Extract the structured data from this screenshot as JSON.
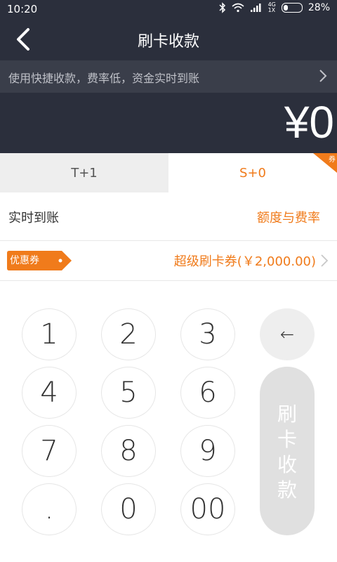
{
  "status": {
    "time": "10:20",
    "network": "4G",
    "signal_sub": "1X",
    "battery": "28%"
  },
  "nav": {
    "title": "刷卡收款"
  },
  "promo": {
    "text": "使用快捷收款，费率低，资金实时到账"
  },
  "amount": {
    "value": "¥0"
  },
  "tabs": [
    {
      "label": "T+1"
    },
    {
      "label": "S+0",
      "badge": "券"
    }
  ],
  "realtime": {
    "label": "实时到账",
    "link": "额度与费率"
  },
  "coupon": {
    "tag": "优惠券",
    "value": "超级刷卡券(￥2,000.00)"
  },
  "keypad": {
    "keys": [
      "1",
      "2",
      "3",
      "4",
      "5",
      "6",
      "7",
      "8",
      "9",
      ".",
      "0",
      "00"
    ],
    "delete": "←"
  },
  "submit": {
    "label": "刷卡收款"
  },
  "colors": {
    "dark_bg": "#2b2f3c",
    "accent": "#f07b1b"
  }
}
